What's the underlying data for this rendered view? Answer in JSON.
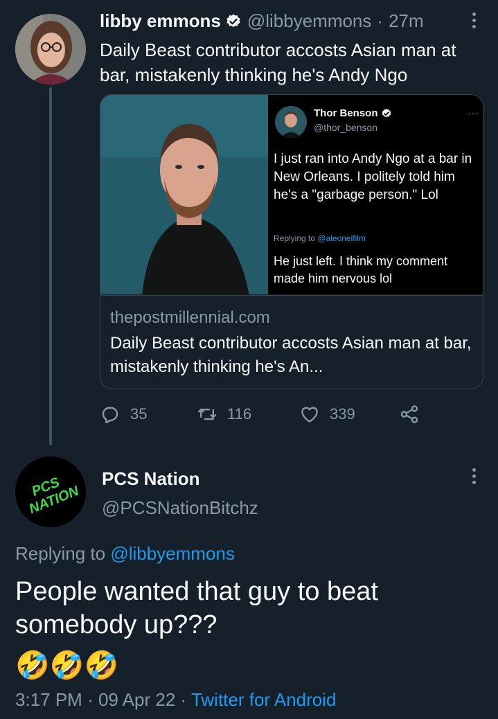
{
  "parent_tweet": {
    "author_name": "libby emmons",
    "handle": "@libbyemmons",
    "separator": "·",
    "time": "27m",
    "text": "Daily Beast contributor accosts Asian man at bar, mistakenly thinking he's Andy Ngo",
    "card": {
      "embedded_tweet": {
        "author_name": "Thor Benson",
        "handle": "@thor_benson",
        "more": "···",
        "text": "I just ran into Andy Ngo at a bar in New Orleans. I politely told him he's a \"garbage person.\" Lol",
        "replying_prefix": "Replying to",
        "replying_mention": "@aleonelfilm",
        "text2": "He just left. I think my comment made him nervous lol"
      },
      "domain": "thepostmillennial.com",
      "title": "Daily Beast contributor accosts Asian man at bar, mistakenly thinking he's An..."
    },
    "actions": {
      "replies": "35",
      "retweets": "116",
      "likes": "339"
    }
  },
  "reply_tweet": {
    "author_name": "PCS Nation",
    "handle": "@PCSNationBitchz",
    "avatar_text": "PCS NATION",
    "replying_prefix": "Replying to",
    "replying_mention": "@libbyemmons",
    "text": "People wanted that guy to beat somebody up???",
    "emojis": "🤣🤣🤣",
    "time": "3:17 PM",
    "date": "09 Apr 22",
    "separator": "·",
    "source": "Twitter for Android"
  },
  "colors": {
    "background": "#15202b",
    "link": "#1d9bf0",
    "secondary_text": "#8b98a5",
    "border": "#38444d",
    "avatar_text_green": "#3ddc4a"
  }
}
